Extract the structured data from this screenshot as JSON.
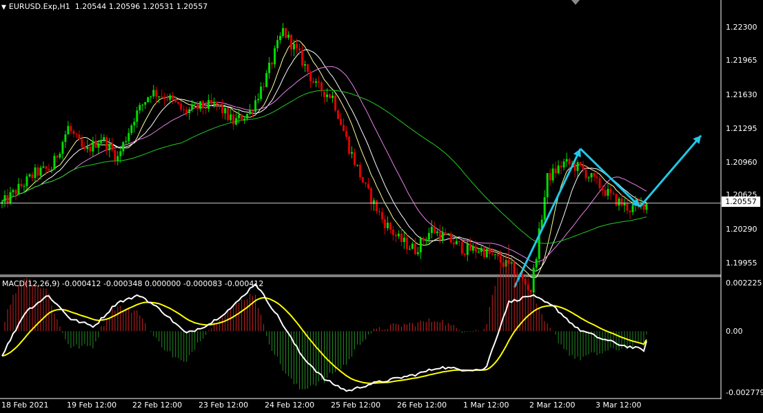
{
  "title": {
    "symbol": "EURUSD.Exp,H1",
    "ohlc": "1.20544 1.20596 1.20531 1.20557"
  },
  "macd": {
    "label": "MACD(12,26,9) -0.000412 -0.000348 0.000000 -0.000083 -0.000412",
    "ticks": [
      "0.002225",
      "0.00",
      "-0.002779"
    ]
  },
  "price_axis": {
    "ticks": [
      "1.22300",
      "1.21965",
      "1.21630",
      "1.21295",
      "1.20960",
      "1.20625",
      "1.20290",
      "1.19955"
    ],
    "current_price": "1.20557"
  },
  "time_axis": {
    "ticks": [
      "18 Feb 2021",
      "19 Feb 12:00",
      "22 Feb 12:00",
      "23 Feb 12:00",
      "24 Feb 12:00",
      "25 Feb 12:00",
      "26 Feb 12:00",
      "1 Mar 12:00",
      "2 Mar 12:00",
      "3 Mar 12:00"
    ]
  },
  "colors": {
    "background": "#000000",
    "bull_candle": "#00dd00",
    "bear_candle": "#e00000",
    "ma_fast": "#ffff99",
    "ma_mid": "#ffffff",
    "ma_slow": "#ee82ee",
    "ma_long": "#22cc22",
    "macd_line": "#ffffff",
    "signal_line": "#ffff00",
    "hist_pos": "#cc2222",
    "hist_neg": "#228b22",
    "arrows": "#21c8e6"
  },
  "chart_data": {
    "type": "candlestick",
    "y_range": [
      1.1985,
      1.2255
    ],
    "price_path": [
      1.2055,
      1.207,
      1.2085,
      1.209,
      1.213,
      1.2105,
      1.212,
      1.21,
      1.214,
      1.2165,
      1.216,
      1.2145,
      1.215,
      1.2152,
      1.2135,
      1.2145,
      1.218,
      1.2225,
      1.22,
      1.217,
      1.216,
      1.211,
      1.207,
      1.204,
      1.202,
      1.201,
      1.203,
      1.202,
      1.201,
      1.201,
      1.2,
      1.199,
      1.197,
      1.208,
      1.2095,
      1.209,
      1.2075,
      1.206,
      1.205,
      1.2056
    ],
    "moving_averages": [
      {
        "color_key": "ma_fast",
        "period": 3
      },
      {
        "color_key": "ma_mid",
        "period": 5
      },
      {
        "color_key": "ma_slow",
        "period": 9
      },
      {
        "color_key": "ma_long",
        "period": 22
      }
    ],
    "annotations": {
      "arrows": [
        {
          "from": [
            31,
            1.1973
          ],
          "to": [
            35,
            1.2109
          ]
        },
        {
          "from": [
            35,
            1.2109
          ],
          "to": [
            38.6,
            1.2052
          ]
        },
        {
          "from": [
            38.6,
            1.2052
          ],
          "to": [
            42.3,
            1.2122
          ]
        }
      ]
    },
    "macd": {
      "y_range": [
        -0.002779,
        0.002225
      ],
      "path": [
        -0.001,
        0.0008,
        0.0015,
        0.0005,
        0.0002,
        0.0012,
        0.0015,
        0.0008,
        -0.0001,
        0.0003,
        0.001,
        0.002,
        0.0006,
        -0.001,
        -0.002,
        -0.0025,
        -0.0022,
        -0.002,
        -0.0018,
        -0.0015,
        -0.0016,
        -0.0016,
        0.0012,
        0.0015,
        0.001,
        0.0001,
        -0.0003,
        -0.0006,
        -0.0008
      ]
    }
  }
}
